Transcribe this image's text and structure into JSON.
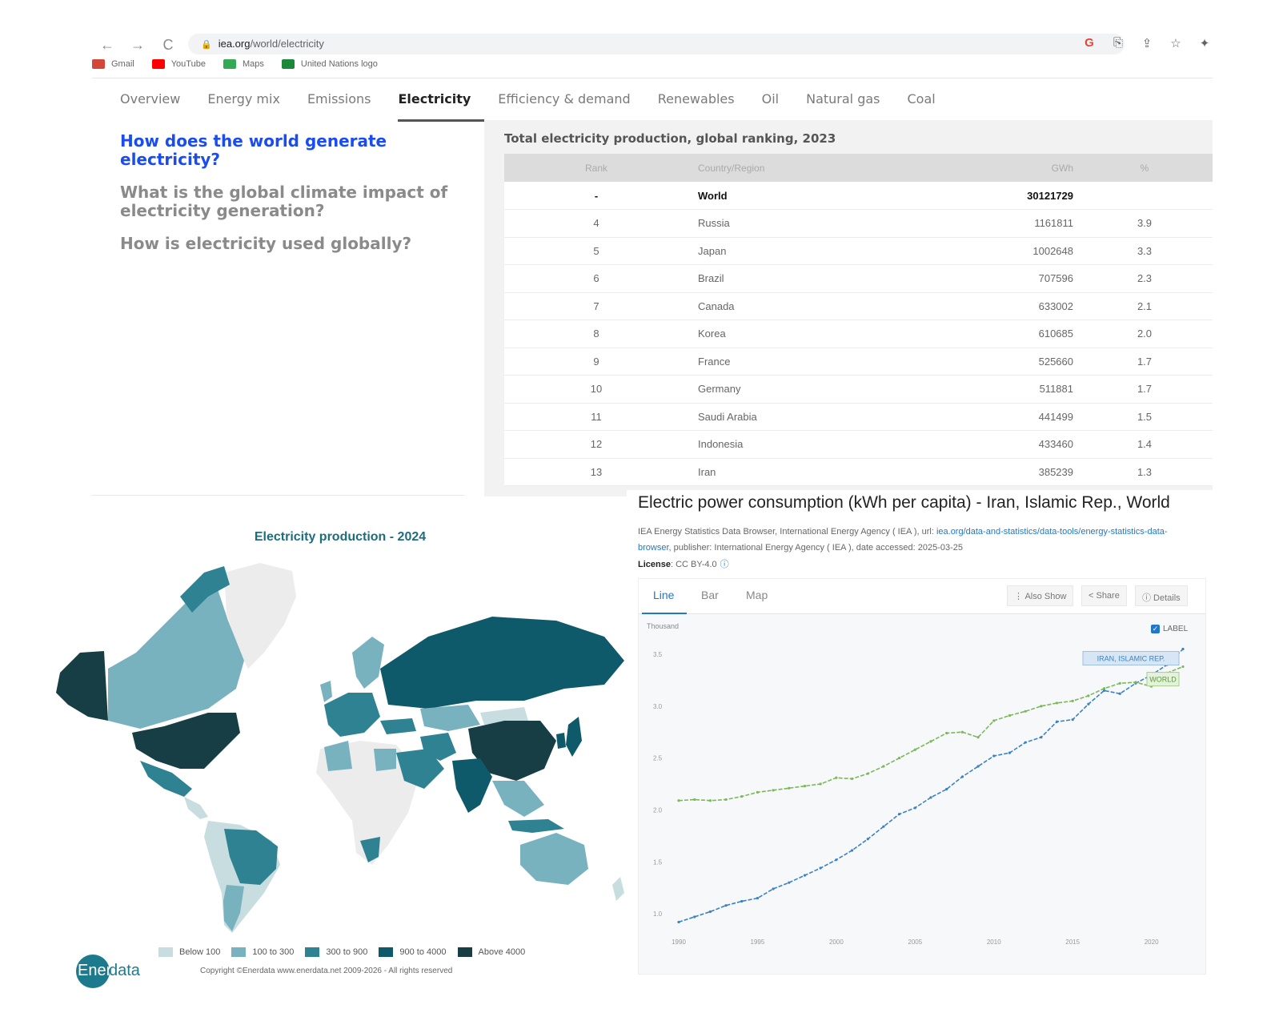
{
  "browser": {
    "url_host": "iea.org",
    "url_path": "/world/electricity",
    "nav": {
      "back": "←",
      "forward": "→",
      "reload": "C"
    },
    "bookmarks": [
      {
        "label": "Gmail",
        "color": "#d44638"
      },
      {
        "label": "YouTube",
        "color": "#ff0000"
      },
      {
        "label": "Maps",
        "color": "#34a853"
      },
      {
        "label": "United Nations logo",
        "color": "#1a8a3a"
      }
    ]
  },
  "iea": {
    "tabs": [
      "Overview",
      "Energy mix",
      "Emissions",
      "Electricity",
      "Efficiency & demand",
      "Renewables",
      "Oil",
      "Natural gas",
      "Coal"
    ],
    "active_tab": "Electricity",
    "questions": [
      "How does the world generate electricity?",
      "What is the global climate impact of electricity generation?",
      "How is electricity used globally?"
    ],
    "table_title": "Total electricity production, global ranking, 2023",
    "columns": [
      "Rank",
      "Country/Region",
      "GWh",
      "%"
    ],
    "rows": [
      {
        "rank": "-",
        "country": "World",
        "gwh": "30121729",
        "pct": ""
      },
      {
        "rank": "4",
        "country": "Russia",
        "gwh": "1161811",
        "pct": "3.9"
      },
      {
        "rank": "5",
        "country": "Japan",
        "gwh": "1002648",
        "pct": "3.3"
      },
      {
        "rank": "6",
        "country": "Brazil",
        "gwh": "707596",
        "pct": "2.3"
      },
      {
        "rank": "7",
        "country": "Canada",
        "gwh": "633002",
        "pct": "2.1"
      },
      {
        "rank": "8",
        "country": "Korea",
        "gwh": "610685",
        "pct": "2.0"
      },
      {
        "rank": "9",
        "country": "France",
        "gwh": "525660",
        "pct": "1.7"
      },
      {
        "rank": "10",
        "country": "Germany",
        "gwh": "511881",
        "pct": "1.7"
      },
      {
        "rank": "11",
        "country": "Saudi Arabia",
        "gwh": "441499",
        "pct": "1.5"
      },
      {
        "rank": "12",
        "country": "Indonesia",
        "gwh": "433460",
        "pct": "1.4"
      },
      {
        "rank": "13",
        "country": "Iran",
        "gwh": "385239",
        "pct": "1.3"
      }
    ]
  },
  "enerdata": {
    "title": "Electricity production - 2024",
    "legend": [
      {
        "label": "Below 100",
        "color": "#c7dde0"
      },
      {
        "label": "100 to 300",
        "color": "#79b2bf"
      },
      {
        "label": "300 to 900",
        "color": "#2f8291"
      },
      {
        "label": "900 to 4000",
        "color": "#0f5a6a"
      },
      {
        "label": "Above 4000",
        "color": "#173d45"
      }
    ],
    "logo_a": "Ener",
    "logo_b": "data",
    "copyright": "Copyright ©Enerdata www.enerdata.net 2009-2026 - All rights reserved"
  },
  "worldbank": {
    "title": "Electric power consumption (kWh per capita) - Iran, Islamic Rep., World",
    "source_prefix": "IEA Energy Statistics Data Browser, International Energy Agency ( IEA ), url: ",
    "source_link": "iea.org/data-and-statistics/data-tools/energy-statistics-data-browser",
    "source_suffix": ", publisher: International Energy Agency ( IEA ), date accessed: 2025-03-25",
    "license_label": "License",
    "license_value": ": CC BY-4.0",
    "tabs": [
      "Line",
      "Bar",
      "Map"
    ],
    "buttons": [
      "⋮ Also Show",
      "< Share",
      "ⓘ Details"
    ],
    "label_toggle": "LABEL"
  },
  "chart_data": {
    "type": "line",
    "ylabel": "Thousand",
    "ylim": [
      0.8,
      3.5
    ],
    "x": [
      1990,
      1991,
      1992,
      1993,
      1994,
      1995,
      1996,
      1997,
      1998,
      1999,
      2000,
      2001,
      2002,
      2003,
      2004,
      2005,
      2006,
      2007,
      2008,
      2009,
      2010,
      2011,
      2012,
      2013,
      2014,
      2015,
      2016,
      2017,
      2018,
      2019,
      2020,
      2021,
      2022
    ],
    "x_ticks": [
      1990,
      1995,
      2000,
      2005,
      2010,
      2015,
      2020
    ],
    "y_ticks": [
      1.0,
      1.5,
      2.0,
      2.5,
      3.0,
      3.5
    ],
    "series": [
      {
        "name": "IRAN, ISLAMIC REP.",
        "color": "#3b82c4",
        "values": [
          0.92,
          0.97,
          1.02,
          1.08,
          1.12,
          1.15,
          1.24,
          1.3,
          1.37,
          1.44,
          1.52,
          1.61,
          1.72,
          1.84,
          1.96,
          2.02,
          2.12,
          2.2,
          2.32,
          2.42,
          2.52,
          2.55,
          2.65,
          2.7,
          2.85,
          2.87,
          3.02,
          3.15,
          3.12,
          3.22,
          3.3,
          3.4,
          3.55
        ]
      },
      {
        "name": "WORLD",
        "color": "#7cb85a",
        "values": [
          2.09,
          2.1,
          2.09,
          2.1,
          2.13,
          2.17,
          2.19,
          2.21,
          2.23,
          2.25,
          2.31,
          2.3,
          2.35,
          2.42,
          2.5,
          2.58,
          2.66,
          2.74,
          2.75,
          2.7,
          2.86,
          2.91,
          2.95,
          3.0,
          3.03,
          3.05,
          3.1,
          3.17,
          3.22,
          3.23,
          3.19,
          3.32,
          3.38
        ]
      }
    ]
  }
}
